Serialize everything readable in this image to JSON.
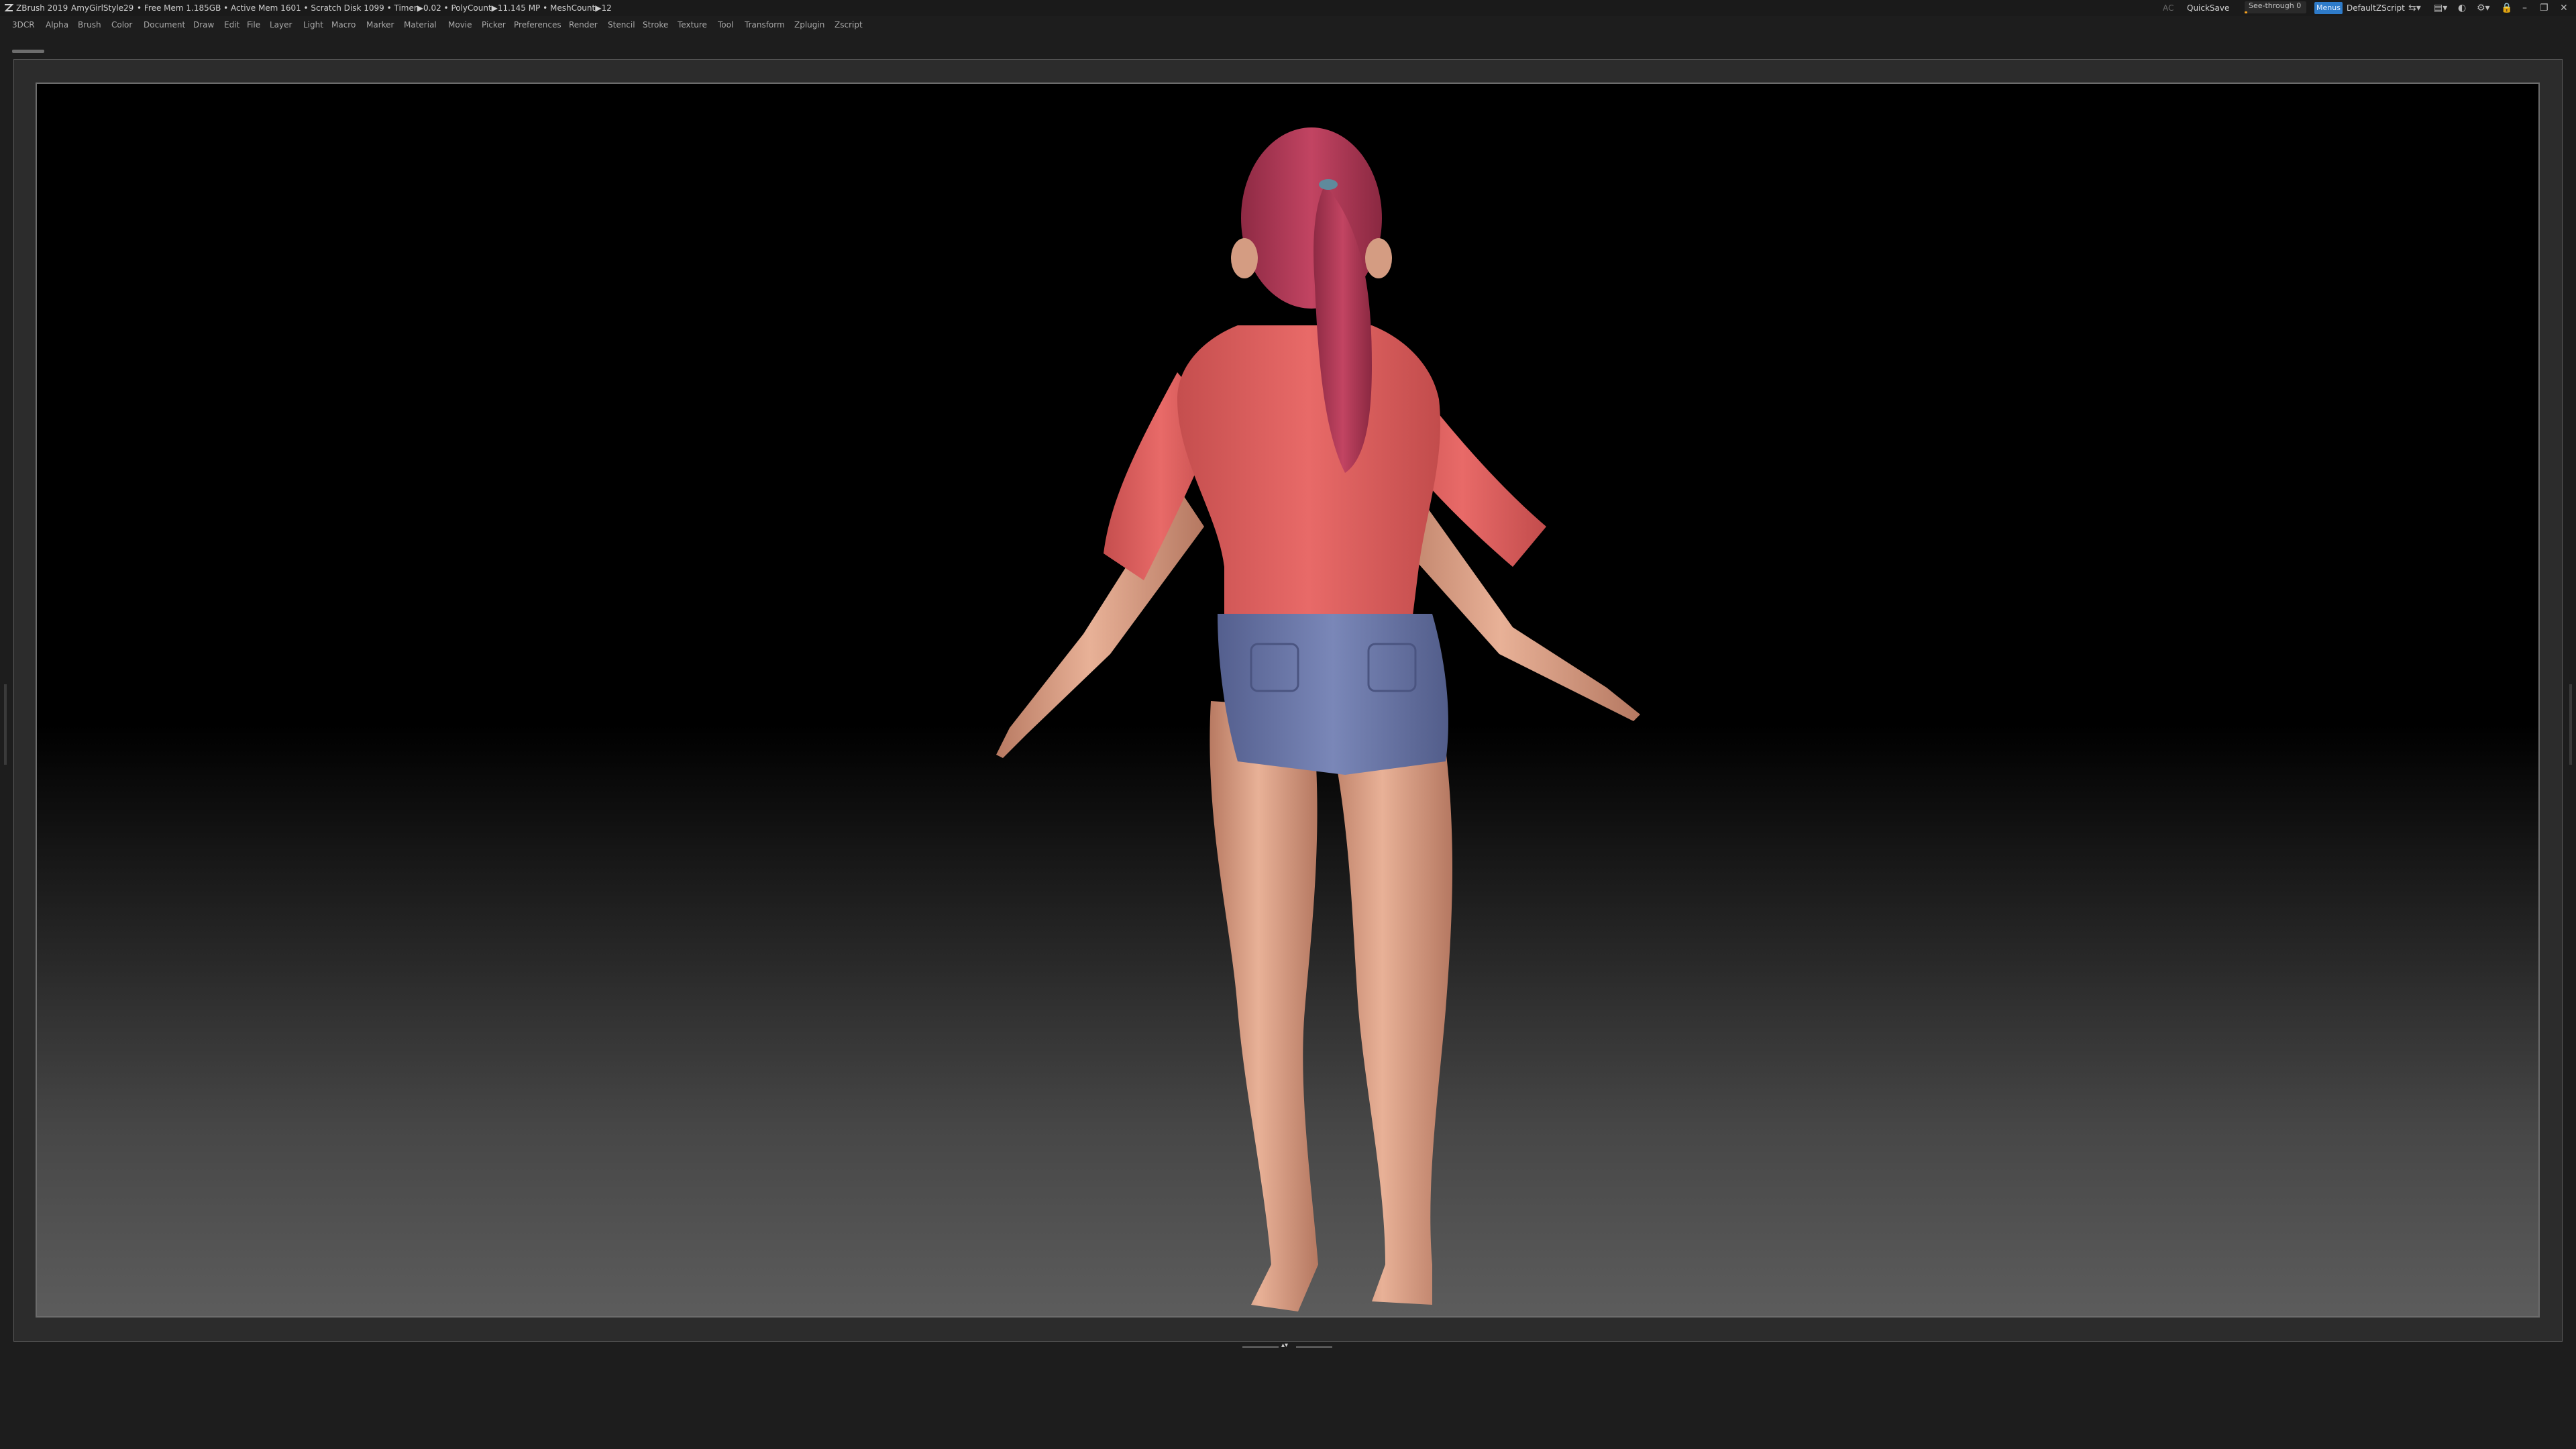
{
  "titlebar": {
    "app_name": "ZBrush 2019",
    "document_name": "AmyGirlStyle29",
    "stats": "• Free Mem 1.185GB • Active Mem 1601 • Scratch Disk 1099 • Timer▶0.02 • PolyCount▶11.145 MP • MeshCount▶12",
    "ac": "AC",
    "quicksave": "QuickSave",
    "see_through_label": "See-through",
    "see_through_value": "0",
    "see_through_fraction": 0.0,
    "menus_label": "Menus",
    "zscript": "DefaultZScript",
    "accent_color": "#f29f1e",
    "menus_color": "#2e7bc9"
  },
  "menus": [
    "3DCR",
    "Alpha",
    "Brush",
    "Color",
    "Document",
    "Draw",
    "Edit",
    "File",
    "Layer",
    "Light",
    "Macro",
    "Marker",
    "Material",
    "Movie",
    "Picker",
    "Preferences",
    "Render",
    "Stencil",
    "Stroke",
    "Texture",
    "Tool",
    "Transform",
    "Zplugin",
    "Zscript"
  ],
  "viewport": {
    "subject": "character-back-view",
    "colors": {
      "hair": "#b13a55",
      "shirt": "#e06060",
      "shorts": "#6a78a8",
      "skin": "#e3a88a"
    }
  }
}
